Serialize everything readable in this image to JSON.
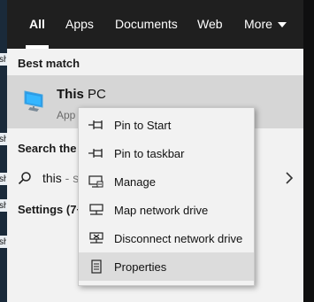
{
  "tabs": [
    {
      "label": "All",
      "active": true
    },
    {
      "label": "Apps"
    },
    {
      "label": "Documents"
    },
    {
      "label": "Web"
    },
    {
      "label": "More"
    }
  ],
  "best_match": {
    "heading": "Best match",
    "title_bold": "This",
    "title_rest": " PC",
    "subtitle": "App",
    "icon": "computer-icon"
  },
  "web_search": {
    "heading": "Search the w",
    "query": "this",
    "suffix": " - s",
    "icon": "search-icon"
  },
  "settings": {
    "heading": "Settings (7+"
  },
  "context_menu": {
    "items": [
      {
        "label": "Pin to Start",
        "icon": "pin-icon"
      },
      {
        "label": "Pin to taskbar",
        "icon": "pin-icon"
      },
      {
        "label": "Manage",
        "icon": "manage-computer-icon"
      },
      {
        "label": "Map network drive",
        "icon": "map-network-drive-icon"
      },
      {
        "label": "Disconnect network drive",
        "icon": "disconnect-network-drive-icon"
      },
      {
        "label": "Properties",
        "icon": "properties-icon",
        "highlighted": true
      }
    ]
  },
  "desktop_edge": {
    "fragments": [
      "sh",
      "sh",
      "sh",
      "sh",
      "sh"
    ]
  },
  "colors": {
    "topbar": "#1f1f1f",
    "panel": "#f2f2f2",
    "selected_row": "#d6d6d6",
    "menu_highlight": "#dcdcdc"
  }
}
